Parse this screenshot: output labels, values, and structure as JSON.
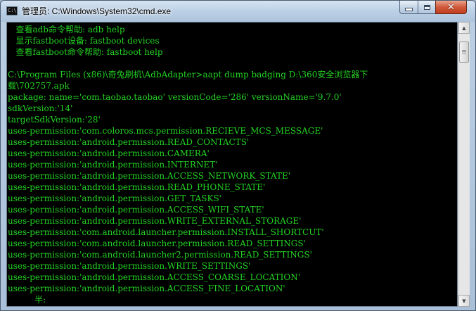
{
  "window": {
    "title": "管理员: C:\\Windows\\System32\\cmd.exe",
    "icon": "cmd-console-icon",
    "icon_text": "C:\\",
    "controls": {
      "minimize_icon": "minimize-icon",
      "maximize_icon": "maximize-icon",
      "close_icon": "close-icon",
      "close_glyph": "✕"
    }
  },
  "colors": {
    "console_bg": "#000000",
    "console_text": "#23d323",
    "close_button": "#c8452b"
  },
  "console": {
    "lines": [
      "   查看adb命令帮助: adb help",
      "   显示fastboot设备: fastboot devices",
      "   查看fastboot命令帮助: fastboot help",
      "",
      "C:\\Program Files (x86)\\奇兔刷机\\AdbAdapter>aapt dump badging D:\\360安全浏览器下",
      "载\\702757.apk",
      "package: name='com.taobao.taobao' versionCode='286' versionName='9.7.0'",
      "sdkVersion:'14'",
      "targetSdkVersion:'28'",
      "uses-permission:'com.coloros.mcs.permission.RECIEVE_MCS_MESSAGE'",
      "uses-permission:'android.permission.READ_CONTACTS'",
      "uses-permission:'android.permission.CAMERA'",
      "uses-permission:'android.permission.INTERNET'",
      "uses-permission:'android.permission.ACCESS_NETWORK_STATE'",
      "uses-permission:'android.permission.READ_PHONE_STATE'",
      "uses-permission:'android.permission.GET_TASKS'",
      "uses-permission:'android.permission.ACCESS_WIFI_STATE'",
      "uses-permission:'android.permission.WRITE_EXTERNAL_STORAGE'",
      "uses-permission:'com.android.launcher.permission.INSTALL_SHORTCUT'",
      "uses-permission:'com.android.launcher.permission.READ_SETTINGS'",
      "uses-permission:'com.android.launcher2.permission.READ_SETTINGS'",
      "uses-permission:'android.permission.WRITE_SETTINGS'",
      "uses-permission:'android.permission.ACCESS_COARSE_LOCATION'",
      "uses-permission:'android.permission.ACCESS_FINE_LOCATION'",
      "          半:"
    ]
  },
  "scrollbar": {
    "up_icon": "scroll-up-arrow-icon",
    "down_icon": "scroll-down-arrow-icon",
    "up_glyph": "▲",
    "down_glyph": "▼"
  }
}
